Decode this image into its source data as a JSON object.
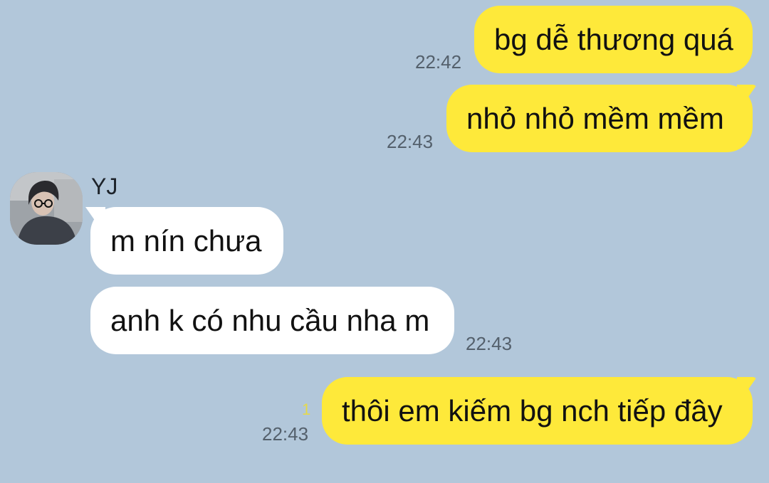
{
  "messages": [
    {
      "text": "bg dễ thương quá",
      "time": "22:42",
      "side": "me"
    },
    {
      "text": "nhỏ nhỏ mềm mềm",
      "time": "22:43",
      "side": "me"
    },
    {
      "sender": "YJ",
      "text": "m nín chưa",
      "side": "them"
    },
    {
      "text": "anh k có nhu cầu nha m",
      "time": "22:43",
      "side": "them"
    },
    {
      "text": "thôi em kiếm bg nch tiếp đây",
      "time": "22:43",
      "unread": "1",
      "side": "me"
    }
  ],
  "colors": {
    "background": "#b2c7da",
    "my_bubble": "#fee93a",
    "their_bubble": "#ffffff",
    "unread_count": "#e6d94a"
  }
}
